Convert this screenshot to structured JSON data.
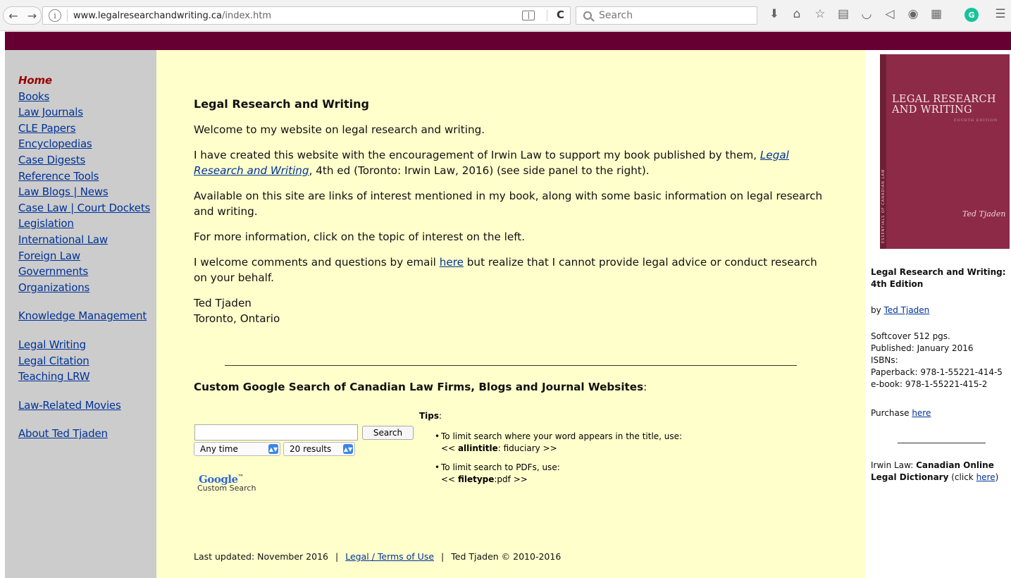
{
  "browser": {
    "url_domain": "www.legalresearchandwriting.ca",
    "url_path": "/index.htm",
    "search_placeholder": "Search",
    "back_glyph": "←",
    "forward_glyph": "→",
    "info_glyph": "i",
    "reload_glyph": "C",
    "toolbar_icons": [
      "download-icon",
      "home-icon",
      "bookmark-star-icon",
      "reading-list-icon",
      "pocket-icon",
      "send-icon",
      "history-icon",
      "qr-code-icon",
      "grammarly-icon",
      "menu-icon"
    ],
    "toolbar_glyphs": [
      "⬇",
      "⌂",
      "☆",
      "▤",
      "◡",
      "◁",
      "◉",
      "▦",
      "G",
      "☰"
    ],
    "grammarly_color": "#15c39a"
  },
  "theme": {
    "banner_color": "#660033",
    "sidebar_bg": "#cccccc",
    "main_bg": "#ffffcc",
    "link_color": "#003399",
    "active_color": "#990000"
  },
  "sidebar": {
    "home": "Home",
    "group1": [
      "Books",
      "Law Journals",
      "CLE Papers",
      "Encyclopedias",
      "Case Digests",
      "Reference Tools",
      "Law Blogs | News",
      "Case Law | Court Dockets",
      "Legislation",
      "International Law",
      "Foreign Law",
      "Governments",
      "Organizations"
    ],
    "group2": [
      "Knowledge Management"
    ],
    "group3": [
      "Legal Writing",
      "Legal Citation",
      "Teaching LRW"
    ],
    "group4": [
      "Law-Related Movies"
    ],
    "group5": [
      "About Ted Tjaden"
    ]
  },
  "main": {
    "heading": "Legal Research and Writing",
    "p1": "Welcome to my website on legal research and writing.",
    "p2_before": "I have created this website with the encouragement of Irwin Law to support my book published by them, ",
    "p2_link": "Legal Research and Writing",
    "p2_after": ", 4th ed (Toronto: Irwin Law, 2016) (see side panel to the right).",
    "p3": "Available on this site are links of interest mentioned in my book, along with some basic information on legal research and writing.",
    "p4": "For more information, click on the topic of interest on the left.",
    "p5_before": "I welcome comments and questions by email ",
    "p5_link": "here",
    "p5_after": " but realize that I cannot provide legal advice or conduct research on your behalf.",
    "sig_name": "Ted Tjaden",
    "sig_place": "Toronto, Ontario",
    "cse_title": "Custom Google Search of Canadian Law Firms, Blogs and Journal Websites",
    "cse_title_colon": ":",
    "tips_label": "Tips",
    "tips_colon": ":",
    "search_button": "Search",
    "search_value": "",
    "time_select": "Any time",
    "results_select": "20 results",
    "select_arrows": "▲▼",
    "google_logo": "Google",
    "google_tm": "™",
    "google_sub": "Custom Search",
    "tip1_line1": "To limit search where your word appears in the title, use:",
    "tip1_prefix": "<< ",
    "tip1_bold": "allintitle",
    "tip1_suffix": ": fiduciary >>",
    "tip2_line1": "To limit search to PDFs, use:",
    "tip2_prefix": "<< ",
    "tip2_bold": "filetype",
    "tip2_suffix": ":pdf >>"
  },
  "footer": {
    "updated": "Last updated: November 2016",
    "sep": "|",
    "legal_link": "Legal / Terms of Use",
    "copyright": "Ted Tjaden © 2010-2016"
  },
  "right_panel": {
    "cover_title": "LEGAL RESEARCH AND WRITING",
    "cover_edition": "FOURTH EDITION",
    "cover_spine": "ESSENTIALS OF CANADIAN LAW",
    "cover_author": "Ted Tjaden",
    "book_title": "Legal Research and Writing: 4th Edition",
    "by": "by ",
    "author_link": "Ted Tjaden",
    "softcover": "Softcover 512 pgs.",
    "published": "Published: January 2016",
    "isbns": "ISBNs:",
    "paperback": "Paperback: 978-1-55221-414-5",
    "ebook": "e-book: 978-1-55221-415-2",
    "purchase": "Purchase ",
    "purchase_link": "here",
    "dict_pre": "Irwin Law: ",
    "dict_bold": "Canadian Online Legal Dictionary",
    "dict_mid": " (click ",
    "dict_link": "here",
    "dict_end": ")"
  }
}
